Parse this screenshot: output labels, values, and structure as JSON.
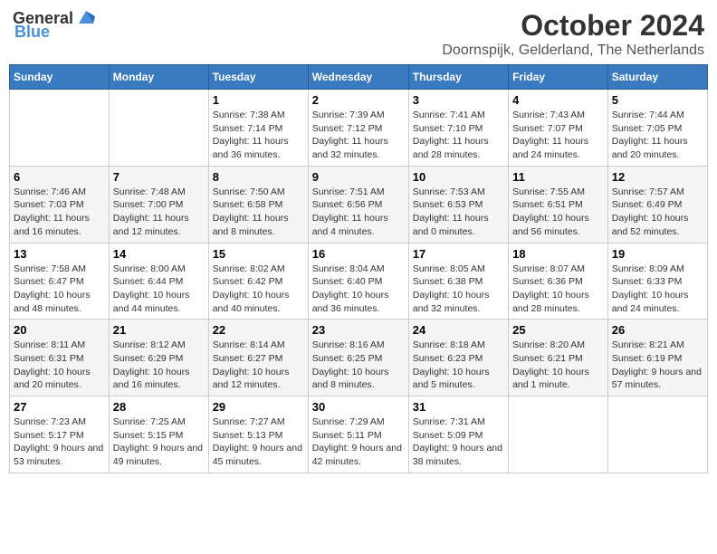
{
  "logo": {
    "general": "General",
    "blue": "Blue"
  },
  "header": {
    "month": "October 2024",
    "location": "Doornspijk, Gelderland, The Netherlands"
  },
  "days_of_week": [
    "Sunday",
    "Monday",
    "Tuesday",
    "Wednesday",
    "Thursday",
    "Friday",
    "Saturday"
  ],
  "weeks": [
    [
      {
        "day": "",
        "info": ""
      },
      {
        "day": "",
        "info": ""
      },
      {
        "day": "1",
        "info": "Sunrise: 7:38 AM\nSunset: 7:14 PM\nDaylight: 11 hours and 36 minutes."
      },
      {
        "day": "2",
        "info": "Sunrise: 7:39 AM\nSunset: 7:12 PM\nDaylight: 11 hours and 32 minutes."
      },
      {
        "day": "3",
        "info": "Sunrise: 7:41 AM\nSunset: 7:10 PM\nDaylight: 11 hours and 28 minutes."
      },
      {
        "day": "4",
        "info": "Sunrise: 7:43 AM\nSunset: 7:07 PM\nDaylight: 11 hours and 24 minutes."
      },
      {
        "day": "5",
        "info": "Sunrise: 7:44 AM\nSunset: 7:05 PM\nDaylight: 11 hours and 20 minutes."
      }
    ],
    [
      {
        "day": "6",
        "info": "Sunrise: 7:46 AM\nSunset: 7:03 PM\nDaylight: 11 hours and 16 minutes."
      },
      {
        "day": "7",
        "info": "Sunrise: 7:48 AM\nSunset: 7:00 PM\nDaylight: 11 hours and 12 minutes."
      },
      {
        "day": "8",
        "info": "Sunrise: 7:50 AM\nSunset: 6:58 PM\nDaylight: 11 hours and 8 minutes."
      },
      {
        "day": "9",
        "info": "Sunrise: 7:51 AM\nSunset: 6:56 PM\nDaylight: 11 hours and 4 minutes."
      },
      {
        "day": "10",
        "info": "Sunrise: 7:53 AM\nSunset: 6:53 PM\nDaylight: 11 hours and 0 minutes."
      },
      {
        "day": "11",
        "info": "Sunrise: 7:55 AM\nSunset: 6:51 PM\nDaylight: 10 hours and 56 minutes."
      },
      {
        "day": "12",
        "info": "Sunrise: 7:57 AM\nSunset: 6:49 PM\nDaylight: 10 hours and 52 minutes."
      }
    ],
    [
      {
        "day": "13",
        "info": "Sunrise: 7:58 AM\nSunset: 6:47 PM\nDaylight: 10 hours and 48 minutes."
      },
      {
        "day": "14",
        "info": "Sunrise: 8:00 AM\nSunset: 6:44 PM\nDaylight: 10 hours and 44 minutes."
      },
      {
        "day": "15",
        "info": "Sunrise: 8:02 AM\nSunset: 6:42 PM\nDaylight: 10 hours and 40 minutes."
      },
      {
        "day": "16",
        "info": "Sunrise: 8:04 AM\nSunset: 6:40 PM\nDaylight: 10 hours and 36 minutes."
      },
      {
        "day": "17",
        "info": "Sunrise: 8:05 AM\nSunset: 6:38 PM\nDaylight: 10 hours and 32 minutes."
      },
      {
        "day": "18",
        "info": "Sunrise: 8:07 AM\nSunset: 6:36 PM\nDaylight: 10 hours and 28 minutes."
      },
      {
        "day": "19",
        "info": "Sunrise: 8:09 AM\nSunset: 6:33 PM\nDaylight: 10 hours and 24 minutes."
      }
    ],
    [
      {
        "day": "20",
        "info": "Sunrise: 8:11 AM\nSunset: 6:31 PM\nDaylight: 10 hours and 20 minutes."
      },
      {
        "day": "21",
        "info": "Sunrise: 8:12 AM\nSunset: 6:29 PM\nDaylight: 10 hours and 16 minutes."
      },
      {
        "day": "22",
        "info": "Sunrise: 8:14 AM\nSunset: 6:27 PM\nDaylight: 10 hours and 12 minutes."
      },
      {
        "day": "23",
        "info": "Sunrise: 8:16 AM\nSunset: 6:25 PM\nDaylight: 10 hours and 8 minutes."
      },
      {
        "day": "24",
        "info": "Sunrise: 8:18 AM\nSunset: 6:23 PM\nDaylight: 10 hours and 5 minutes."
      },
      {
        "day": "25",
        "info": "Sunrise: 8:20 AM\nSunset: 6:21 PM\nDaylight: 10 hours and 1 minute."
      },
      {
        "day": "26",
        "info": "Sunrise: 8:21 AM\nSunset: 6:19 PM\nDaylight: 9 hours and 57 minutes."
      }
    ],
    [
      {
        "day": "27",
        "info": "Sunrise: 7:23 AM\nSunset: 5:17 PM\nDaylight: 9 hours and 53 minutes."
      },
      {
        "day": "28",
        "info": "Sunrise: 7:25 AM\nSunset: 5:15 PM\nDaylight: 9 hours and 49 minutes."
      },
      {
        "day": "29",
        "info": "Sunrise: 7:27 AM\nSunset: 5:13 PM\nDaylight: 9 hours and 45 minutes."
      },
      {
        "day": "30",
        "info": "Sunrise: 7:29 AM\nSunset: 5:11 PM\nDaylight: 9 hours and 42 minutes."
      },
      {
        "day": "31",
        "info": "Sunrise: 7:31 AM\nSunset: 5:09 PM\nDaylight: 9 hours and 38 minutes."
      },
      {
        "day": "",
        "info": ""
      },
      {
        "day": "",
        "info": ""
      }
    ]
  ]
}
